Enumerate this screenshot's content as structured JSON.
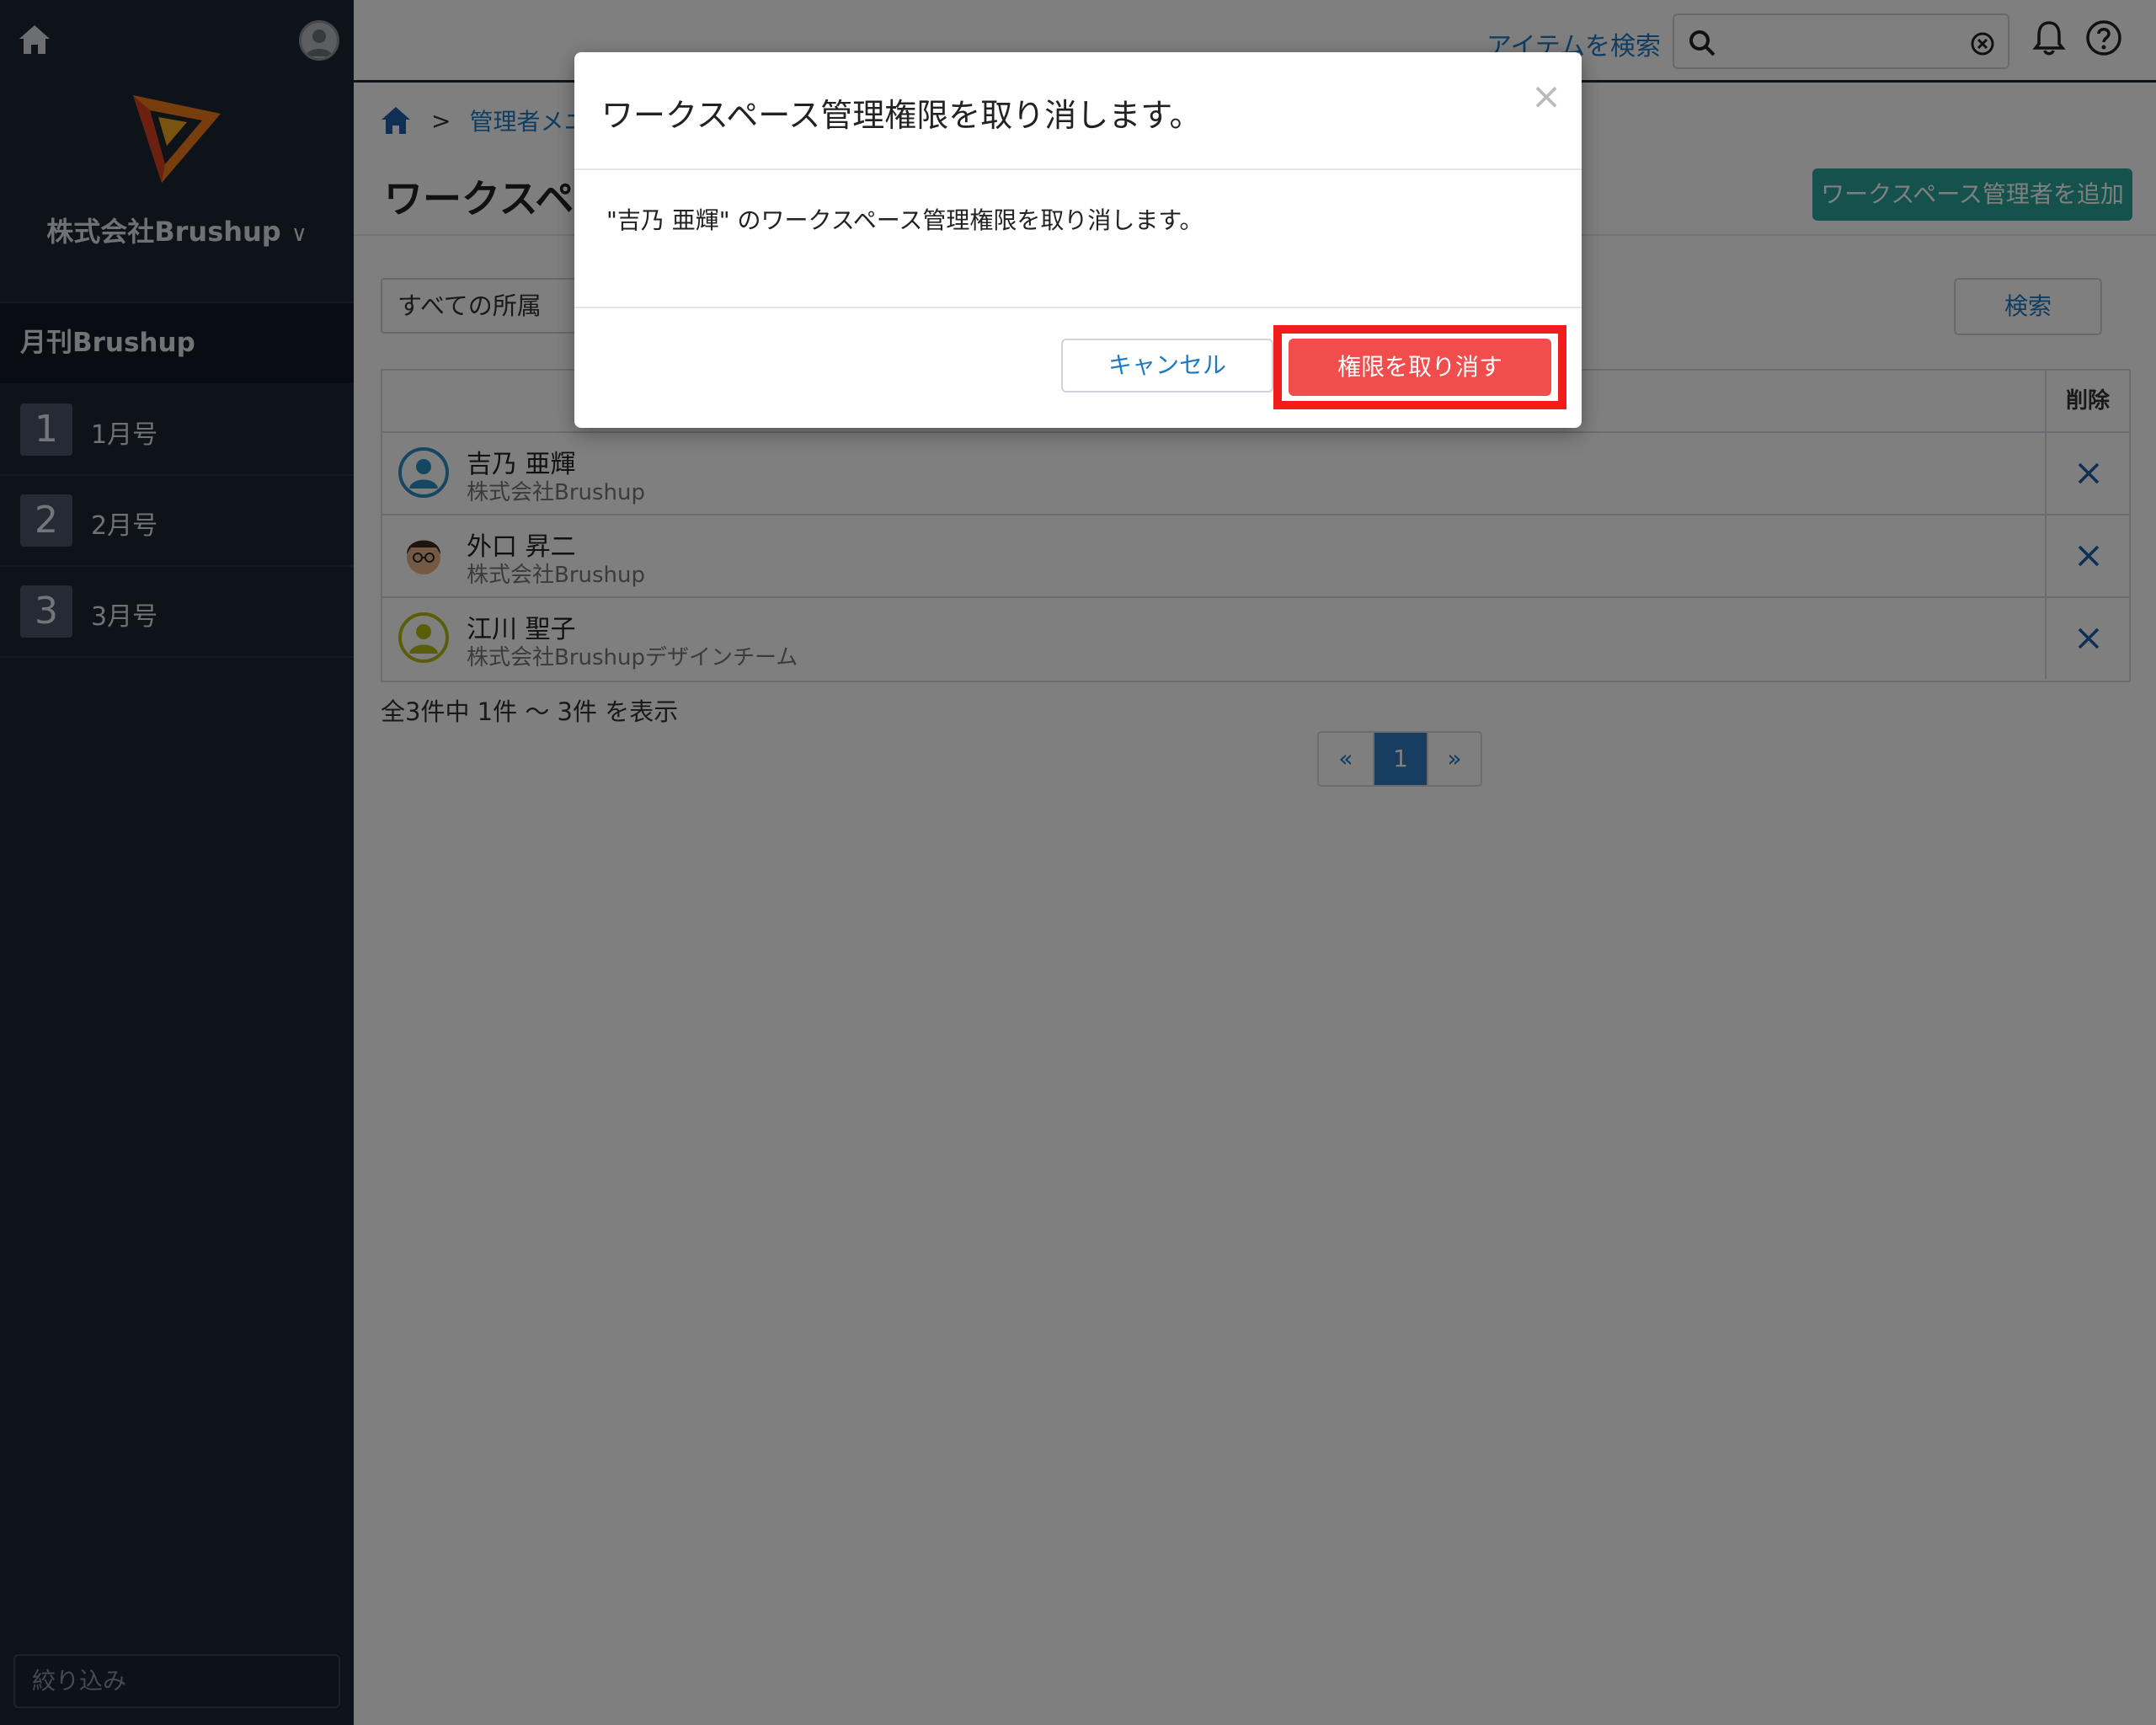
{
  "sidebar": {
    "company_name": "株式会社Brushup",
    "workspace_name": "月刊Brushup",
    "items": [
      {
        "num": "1",
        "label": "1月号"
      },
      {
        "num": "2",
        "label": "2月号"
      },
      {
        "num": "3",
        "label": "3月号"
      }
    ],
    "filter_placeholder": "絞り込み"
  },
  "topbar": {
    "search_link": "アイテムを検索"
  },
  "breadcrumb": {
    "separator": ">",
    "link": "管理者メニ"
  },
  "page": {
    "title": "ワークスペ",
    "add_button": "ワークスペース管理者を追加",
    "filter_select": "すべての所属",
    "search_button": "検索",
    "table_header_delete": "削除",
    "rows": [
      {
        "name": "吉乃 亜輝",
        "org": "株式会社Brushup"
      },
      {
        "name": "外口 昇二",
        "org": "株式会社Brushup"
      },
      {
        "name": "江川 聖子",
        "org": "株式会社Brushupデザインチーム"
      }
    ],
    "count_text": "全3件中 1件 〜 3件 を表示",
    "pager": {
      "prev": "«",
      "current": "1",
      "next": "»"
    }
  },
  "modal": {
    "title": "ワークスペース管理権限を取り消します。",
    "close": "×",
    "body": "\"吉乃 亜輝\" のワークスペース管理権限を取り消します。",
    "cancel_button": "キャンセル",
    "revoke_button": "権限を取り消す"
  },
  "colors": {
    "sidebar_bg": "#1c2433",
    "link": "#1e7ac2",
    "teal_button": "#2aa59a",
    "danger": "#f24d4d",
    "highlight": "#f21c1c",
    "pager_active": "#2f7bc0"
  }
}
